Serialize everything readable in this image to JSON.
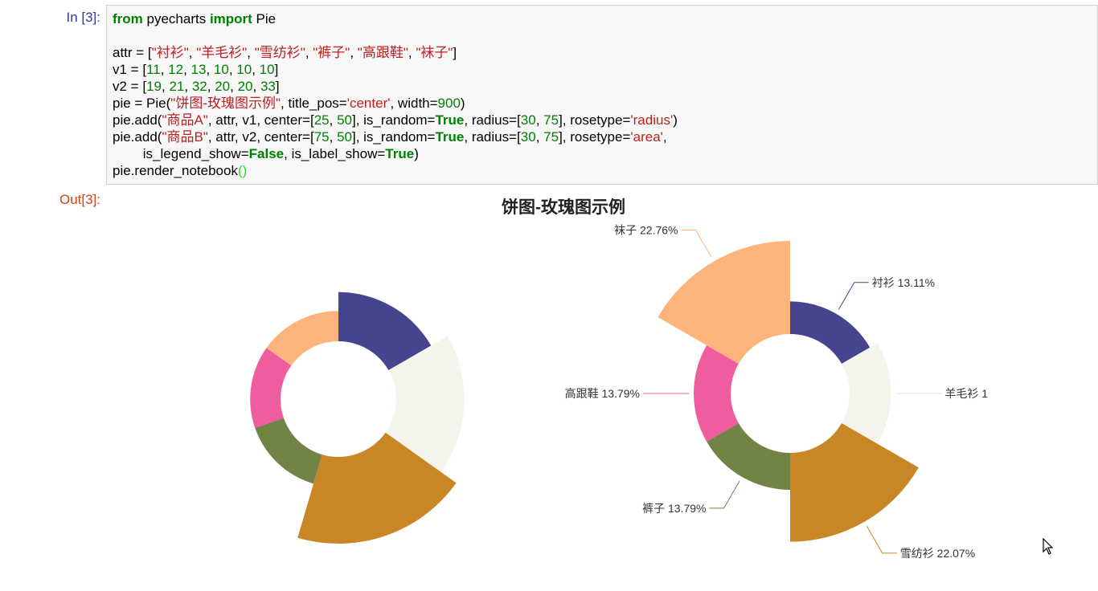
{
  "cell": {
    "in_prompt": "In [3]:",
    "out_prompt": "Out[3]:",
    "code_lines": [
      [
        {
          "t": "from",
          "c": "kw"
        },
        {
          "t": " pyecharts "
        },
        {
          "t": "import",
          "c": "kw"
        },
        {
          "t": " Pie"
        }
      ],
      [],
      [
        {
          "t": "attr = ["
        },
        {
          "t": "\"衬衫\"",
          "c": "str"
        },
        {
          "t": ", "
        },
        {
          "t": "\"羊毛衫\"",
          "c": "str"
        },
        {
          "t": ", "
        },
        {
          "t": "\"雪纺衫\"",
          "c": "str"
        },
        {
          "t": ", "
        },
        {
          "t": "\"裤子\"",
          "c": "str"
        },
        {
          "t": ", "
        },
        {
          "t": "\"高跟鞋\"",
          "c": "str"
        },
        {
          "t": ", "
        },
        {
          "t": "\"袜子\"",
          "c": "str"
        },
        {
          "t": "]"
        }
      ],
      [
        {
          "t": "v1 = ["
        },
        {
          "t": "11",
          "c": "num"
        },
        {
          "t": ", "
        },
        {
          "t": "12",
          "c": "num"
        },
        {
          "t": ", "
        },
        {
          "t": "13",
          "c": "num"
        },
        {
          "t": ", "
        },
        {
          "t": "10",
          "c": "num"
        },
        {
          "t": ", "
        },
        {
          "t": "10",
          "c": "num"
        },
        {
          "t": ", "
        },
        {
          "t": "10",
          "c": "num"
        },
        {
          "t": "]"
        }
      ],
      [
        {
          "t": "v2 = ["
        },
        {
          "t": "19",
          "c": "num"
        },
        {
          "t": ", "
        },
        {
          "t": "21",
          "c": "num"
        },
        {
          "t": ", "
        },
        {
          "t": "32",
          "c": "num"
        },
        {
          "t": ", "
        },
        {
          "t": "20",
          "c": "num"
        },
        {
          "t": ", "
        },
        {
          "t": "20",
          "c": "num"
        },
        {
          "t": ", "
        },
        {
          "t": "33",
          "c": "num"
        },
        {
          "t": "]"
        }
      ],
      [
        {
          "t": "pie = Pie("
        },
        {
          "t": "\"饼图-玫瑰图示例\"",
          "c": "str"
        },
        {
          "t": ", title_pos="
        },
        {
          "t": "'center'",
          "c": "str"
        },
        {
          "t": ", width="
        },
        {
          "t": "900",
          "c": "num"
        },
        {
          "t": ")"
        }
      ],
      [
        {
          "t": "pie.add("
        },
        {
          "t": "\"商品A\"",
          "c": "str"
        },
        {
          "t": ", attr, v1, center=["
        },
        {
          "t": "25",
          "c": "num"
        },
        {
          "t": ", "
        },
        {
          "t": "50",
          "c": "num"
        },
        {
          "t": "], is_random="
        },
        {
          "t": "True",
          "c": "bool"
        },
        {
          "t": ", radius=["
        },
        {
          "t": "30",
          "c": "num"
        },
        {
          "t": ", "
        },
        {
          "t": "75",
          "c": "num"
        },
        {
          "t": "], rosetype="
        },
        {
          "t": "'radius'",
          "c": "str"
        },
        {
          "t": ")"
        }
      ],
      [
        {
          "t": "pie.add("
        },
        {
          "t": "\"商品B\"",
          "c": "str"
        },
        {
          "t": ", attr, v2, center=["
        },
        {
          "t": "75",
          "c": "num"
        },
        {
          "t": ", "
        },
        {
          "t": "50",
          "c": "num"
        },
        {
          "t": "], is_random="
        },
        {
          "t": "True",
          "c": "bool"
        },
        {
          "t": ", radius=["
        },
        {
          "t": "30",
          "c": "num"
        },
        {
          "t": ", "
        },
        {
          "t": "75",
          "c": "num"
        },
        {
          "t": "], rosetype="
        },
        {
          "t": "'area'",
          "c": "str"
        },
        {
          "t": ","
        }
      ],
      [
        {
          "t": "        is_legend_show="
        },
        {
          "t": "False",
          "c": "bool"
        },
        {
          "t": ", is_label_show="
        },
        {
          "t": "True",
          "c": "bool"
        },
        {
          "t": ")"
        }
      ],
      [
        {
          "t": "pie.render_notebook"
        },
        {
          "t": "()",
          "c": "paren"
        }
      ]
    ]
  },
  "chart_data": {
    "type": "pie",
    "title": "饼图-玫瑰图示例",
    "categories": [
      "衬衫",
      "羊毛衫",
      "雪纺衫",
      "裤子",
      "高跟鞋",
      "袜子"
    ],
    "colors": [
      "#44448f",
      "#f4f4ec",
      "#c98625",
      "#718445",
      "#ef5d9f",
      "#fbb47c"
    ],
    "series": [
      {
        "name": "商品A",
        "rosetype": "radius",
        "values": [
          11,
          12,
          13,
          10,
          10,
          10
        ]
      },
      {
        "name": "商品B",
        "rosetype": "area",
        "values": [
          19,
          21,
          32,
          20,
          20,
          33
        ],
        "labels": [
          "衬衫 13.11%",
          "羊毛衫 1",
          "雪纺衫 22.07%",
          "裤子 13.79%",
          "高跟鞋 13.79%",
          "袜子 22.76%"
        ]
      }
    ]
  }
}
